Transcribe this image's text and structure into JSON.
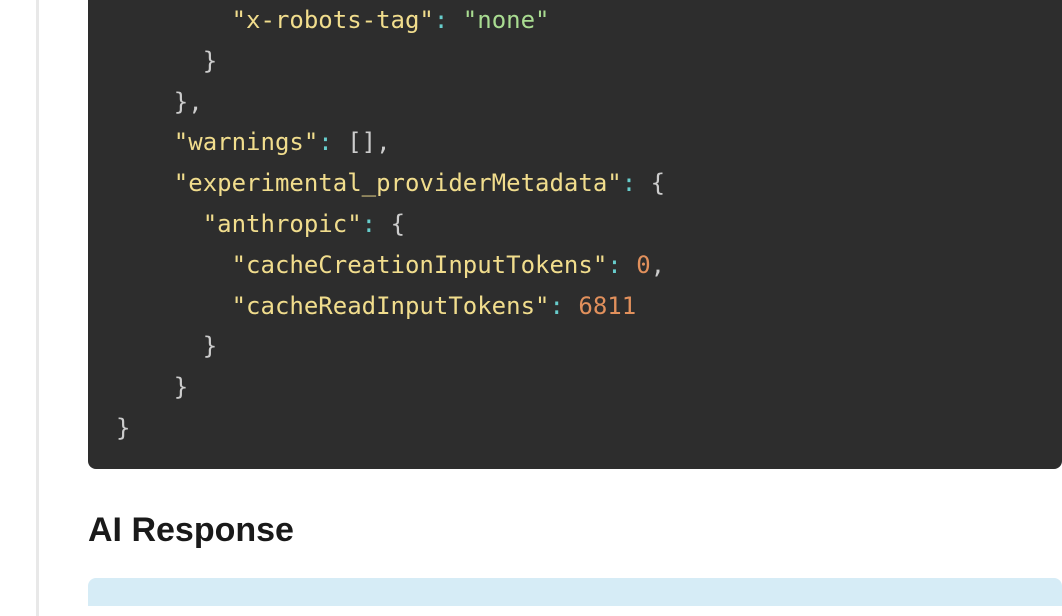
{
  "code": {
    "line1_key": "\"x-robots-tag\"",
    "line1_val": "\"none\"",
    "line2": "      }",
    "line3": "    },",
    "line4_key": "\"warnings\"",
    "line4_val": "[]",
    "line5_key": "\"experimental_providerMetadata\"",
    "line6_key": "\"anthropic\"",
    "line7_key": "\"cacheCreationInputTokens\"",
    "line7_val": "0",
    "line8_key": "\"cacheReadInputTokens\"",
    "line8_val": "6811",
    "line9": "      }",
    "line10": "    }",
    "line11": "}"
  },
  "heading": "AI Response"
}
